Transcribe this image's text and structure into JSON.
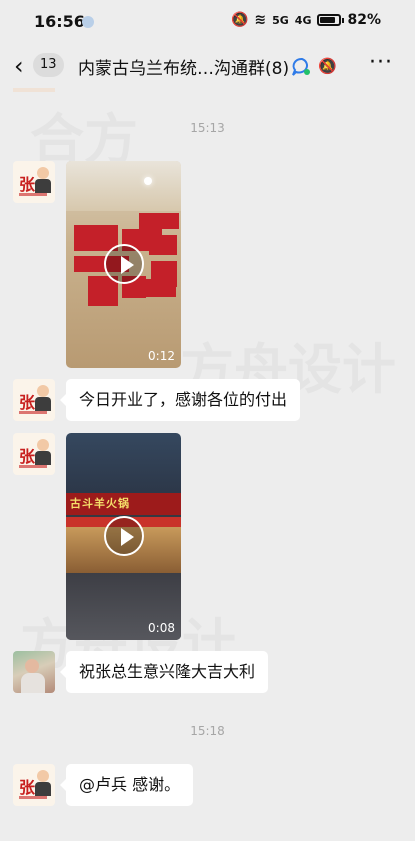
{
  "status_bar": {
    "time": "16:56",
    "signal_5g": "5G",
    "signal_4g": "4G",
    "battery": "82%"
  },
  "header": {
    "unread_count": "13",
    "title_part1": "内蒙古乌兰布统",
    "title_part2": "…沟通群(8)",
    "icons": [
      "back-icon",
      "group-chat-icon",
      "mute-icon",
      "more-icon"
    ]
  },
  "messages": [
    {
      "type": "timestamp",
      "text": "15:13"
    },
    {
      "type": "video",
      "sender": "张",
      "duration": "0:12"
    },
    {
      "type": "text",
      "sender": "张",
      "text": "今日开业了，感谢各位的付出"
    },
    {
      "type": "video",
      "sender": "张",
      "duration": "0:08",
      "sign_text": "古斗羊火锅"
    },
    {
      "type": "text",
      "sender": "photo",
      "text": "祝张总生意兴隆大吉大利"
    },
    {
      "type": "timestamp",
      "text": "15:18"
    },
    {
      "type": "text",
      "sender": "张",
      "text": "@卢兵  感谢。"
    }
  ],
  "avatar_label": "张",
  "colors": {
    "background": "#ededed",
    "bubble": "#ffffff",
    "accent_red": "#c8201f",
    "timestamp": "#a6a6a6"
  }
}
